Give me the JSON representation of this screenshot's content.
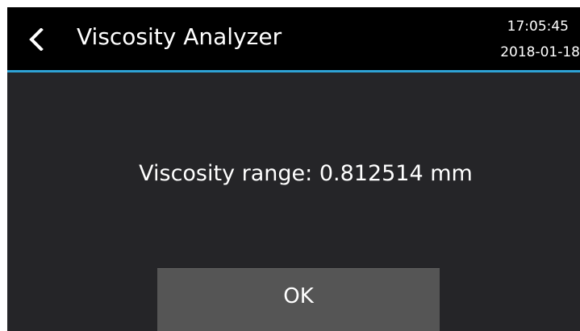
{
  "header": {
    "back_icon": "chevron-left-icon",
    "title": "Viscosity Analyzer",
    "time": "17:05:45",
    "date": "2018-01-18"
  },
  "dialog": {
    "message": "Viscosity range: 0.812514 mm",
    "ok_label": "OK"
  },
  "colors": {
    "header_background": "#000000",
    "accent_line": "#2ea3d6",
    "body_background": "#252528",
    "button_background": "#555555",
    "text": "#ffffff"
  }
}
